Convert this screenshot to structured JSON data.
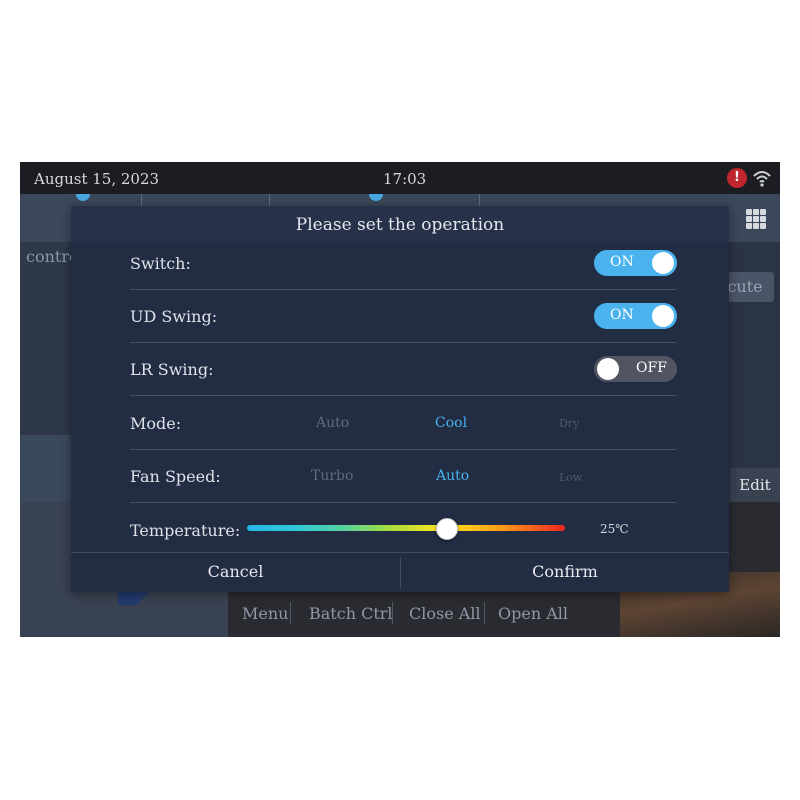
{
  "status_bar": {
    "date": "August 15, 2023",
    "time": "17:03",
    "alert_icon": "alert-icon",
    "alert_glyph": "!",
    "wifi_icon": "wifi-icon"
  },
  "background": {
    "control_text": "contro",
    "execute_text": "ecute",
    "edit_text": "Edit",
    "grid_icon": "grid-menu-icon",
    "bottom_nav": [
      "Menu",
      "Batch Ctrl",
      "Close All",
      "Open All"
    ]
  },
  "dialog": {
    "title": "Please set the operation",
    "switch": {
      "label": "Switch:",
      "state": "ON"
    },
    "ud_swing": {
      "label": "UD Swing:",
      "state": "ON"
    },
    "lr_swing": {
      "label": "LR Swing:",
      "state": "OFF"
    },
    "mode": {
      "label": "Mode:",
      "options": [
        "Auto",
        "Cool",
        "Dry"
      ],
      "selected": "Cool"
    },
    "fan_speed": {
      "label": "Fan Speed:",
      "options": [
        "Turbo",
        "Auto",
        "Low"
      ],
      "selected": "Auto"
    },
    "temperature": {
      "label": "Temperature:",
      "value": "25℃",
      "slider_fraction": 0.63
    },
    "cancel_label": "Cancel",
    "confirm_label": "Confirm"
  },
  "colors": {
    "accent": "#48b0ee",
    "toggle_on": "#4ab3ee",
    "toggle_off": "#505561",
    "dialog_bg": "#222c43",
    "alert": "#c0262d"
  }
}
